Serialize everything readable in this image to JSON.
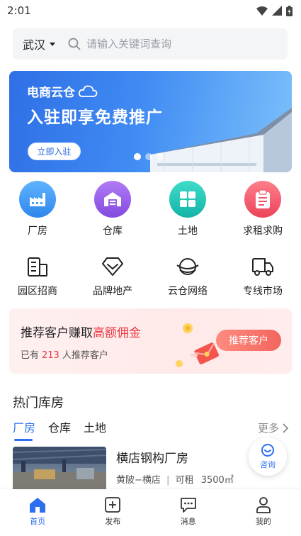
{
  "status": {
    "time": "2:01"
  },
  "search": {
    "city": "武汉",
    "placeholder": "请输入关键词查询"
  },
  "banner": {
    "brand": "电商云仓",
    "title": "入驻即享免费推广",
    "button": "立即入驻"
  },
  "categories": [
    {
      "label": "厂房",
      "icon": "factory-icon",
      "color": "#3d9bf0"
    },
    {
      "label": "仓库",
      "icon": "warehouse-icon",
      "color": "#9b63e8"
    },
    {
      "label": "土地",
      "icon": "land-icon",
      "color": "#20c4b8"
    },
    {
      "label": "求租求购",
      "icon": "clipboard-icon",
      "color": "#f0566a"
    }
  ],
  "services": [
    {
      "label": "园区招商",
      "icon": "park-building-icon"
    },
    {
      "label": "品牌地产",
      "icon": "brand-diamond-icon"
    },
    {
      "label": "云仓网络",
      "icon": "cloud-network-icon"
    },
    {
      "label": "专线市场",
      "icon": "truck-icon"
    }
  ],
  "promo": {
    "title_prefix": "推荐客户赚取",
    "title_highlight": "高额佣金",
    "sub_prefix": "已有",
    "count": "213",
    "sub_suffix": "人推荐客户",
    "button": "推荐客户"
  },
  "hot": {
    "title": "热门库房",
    "tabs": [
      "厂房",
      "仓库",
      "土地"
    ],
    "more": "更多",
    "listing": {
      "title": "横店钢构厂房",
      "location": "黄陂−横店",
      "type": "可租",
      "area": "3500㎡"
    }
  },
  "consult": "咨询",
  "nav": [
    {
      "label": "首页",
      "icon": "home-icon"
    },
    {
      "label": "发布",
      "icon": "add-square-icon"
    },
    {
      "label": "消息",
      "icon": "message-icon"
    },
    {
      "label": "我的",
      "icon": "user-icon"
    }
  ],
  "colors": {
    "accent": "#2d6ff0",
    "highlight": "#e8373f"
  }
}
